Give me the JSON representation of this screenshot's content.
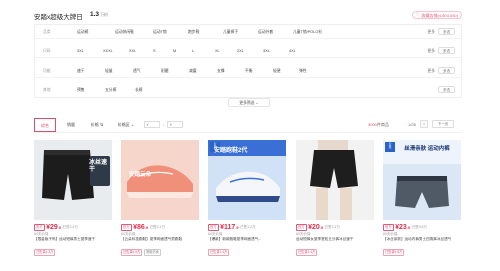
{
  "header": {
    "store_name": "安踏x超级大牌日",
    "count": "1.3",
    "count_unit": "万粉",
    "fav_label": "收藏店铺(4,803,530)"
  },
  "filters": {
    "rows": [
      {
        "label": "品类",
        "options": [
          "运动裤",
          "运动休闲鞋",
          "运动T恤",
          "跑步鞋",
          "儿童裤子",
          "运动外套",
          "儿童T恤/POLO衫"
        ]
      },
      {
        "label": "尺码",
        "options": [
          "3XL",
          "XXXL",
          "XXL",
          "S",
          "M",
          "L",
          "XL",
          "2XL",
          "3XL",
          "4XL"
        ]
      },
      {
        "label": "功能",
        "options": [
          "速干",
          "轻量",
          "透气",
          "耐磨",
          "减震",
          "支撑",
          "平衡",
          "轻便",
          "弹性"
        ]
      },
      {
        "label": "其他",
        "options": [
          "预售",
          "五分裤",
          "长裤"
        ]
      }
    ],
    "more_label": "更多",
    "multi_label": "多选",
    "more_filters_label": "更多筛选"
  },
  "sort": {
    "tabs": [
      "综合",
      "销量",
      "价格"
    ],
    "price_label": "价格区",
    "price_min_placeholder": "¥",
    "price_sep": "-",
    "price_max_placeholder": "¥",
    "result_count": "3000",
    "result_suffix": "件商品",
    "page_current": "1",
    "page_total": "/25",
    "prev_label": "<",
    "next_label": "下一页"
  },
  "products": [
    {
      "sale_tag": "官方",
      "price": "¥29",
      "price_cents": ".9",
      "sold": "已售2.4万",
      "ship": "60天价保",
      "title": "【限量版子码】运动短裤男士夏季速干",
      "badges": [
        "已售量4.3万",
        ""
      ],
      "img_text": "冰丝速干"
    },
    {
      "sale_tag": "官方",
      "price": "¥86",
      "price_cents": ".9",
      "sold": "已售2.1万",
      "ship": "60天价保",
      "title": "【云朵科技跑鞋】夏季网面透气男跑鞋",
      "badges": [
        "已售量5.9万",
        "跑鞋热卖"
      ],
      "img_text": "安踏云朵"
    },
    {
      "sale_tag": "官方",
      "price": "¥117",
      "price_cents": ".9",
      "sold": "已售1.2万",
      "ship": "60天价保",
      "title": "【爆款】新款跑鞋夏季网面透气...",
      "badges": [
        "已售量2.4万",
        ""
      ],
      "img_text": "安踏跑鞋2代"
    },
    {
      "sale_tag": "官方",
      "price": "¥20",
      "price_cents": ".9",
      "sold": "已售2.1万",
      "ship": "60天价保",
      "title": "运动短裤女夏季宽松五分裤冰丝速干",
      "badges": [
        "已售量3.4万",
        ""
      ],
      "img_text": ""
    },
    {
      "sale_tag": "官方",
      "price": "¥23",
      "price_cents": ".9",
      "sold": "已售9.8万",
      "ship": "60天价保",
      "title": "【冰丝亲肤】运动内裤男士四角裤冰丝透气",
      "badges": [
        "已售量9.8万",
        ""
      ],
      "img_text": "丝滑亲肤 运动内裤"
    }
  ],
  "colors": {
    "accent": "#d9506f",
    "price": "#e0304d",
    "promo_blue": "#2a62c9"
  }
}
